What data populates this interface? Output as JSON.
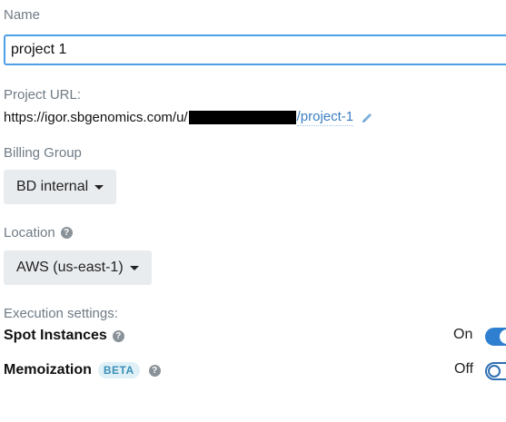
{
  "form": {
    "name_label": "Name",
    "name_value": "project 1",
    "project_url_label": "Project URL:",
    "project_url_prefix": "https://igor.sbgenomics.com/u/",
    "project_url_suffix": "/project-1",
    "billing_group_label": "Billing Group",
    "billing_group_value": "BD internal",
    "location_label": "Location",
    "location_value": "AWS (us-east-1)",
    "help_glyph": "?"
  },
  "execution": {
    "heading": "Execution settings:",
    "spot_instances": {
      "label": "Spot Instances",
      "state_text": "On"
    },
    "memoization": {
      "label": "Memoization",
      "badge": "BETA",
      "state_text": "Off"
    }
  },
  "colors": {
    "accent": "#2f7fd1",
    "link": "#3a7fc4",
    "label": "#6f7b86",
    "dropdown_bg": "#e9ecef"
  },
  "icons": {
    "pencil": "pencil-icon",
    "help": "help-icon",
    "caret": "caret-down-icon"
  }
}
